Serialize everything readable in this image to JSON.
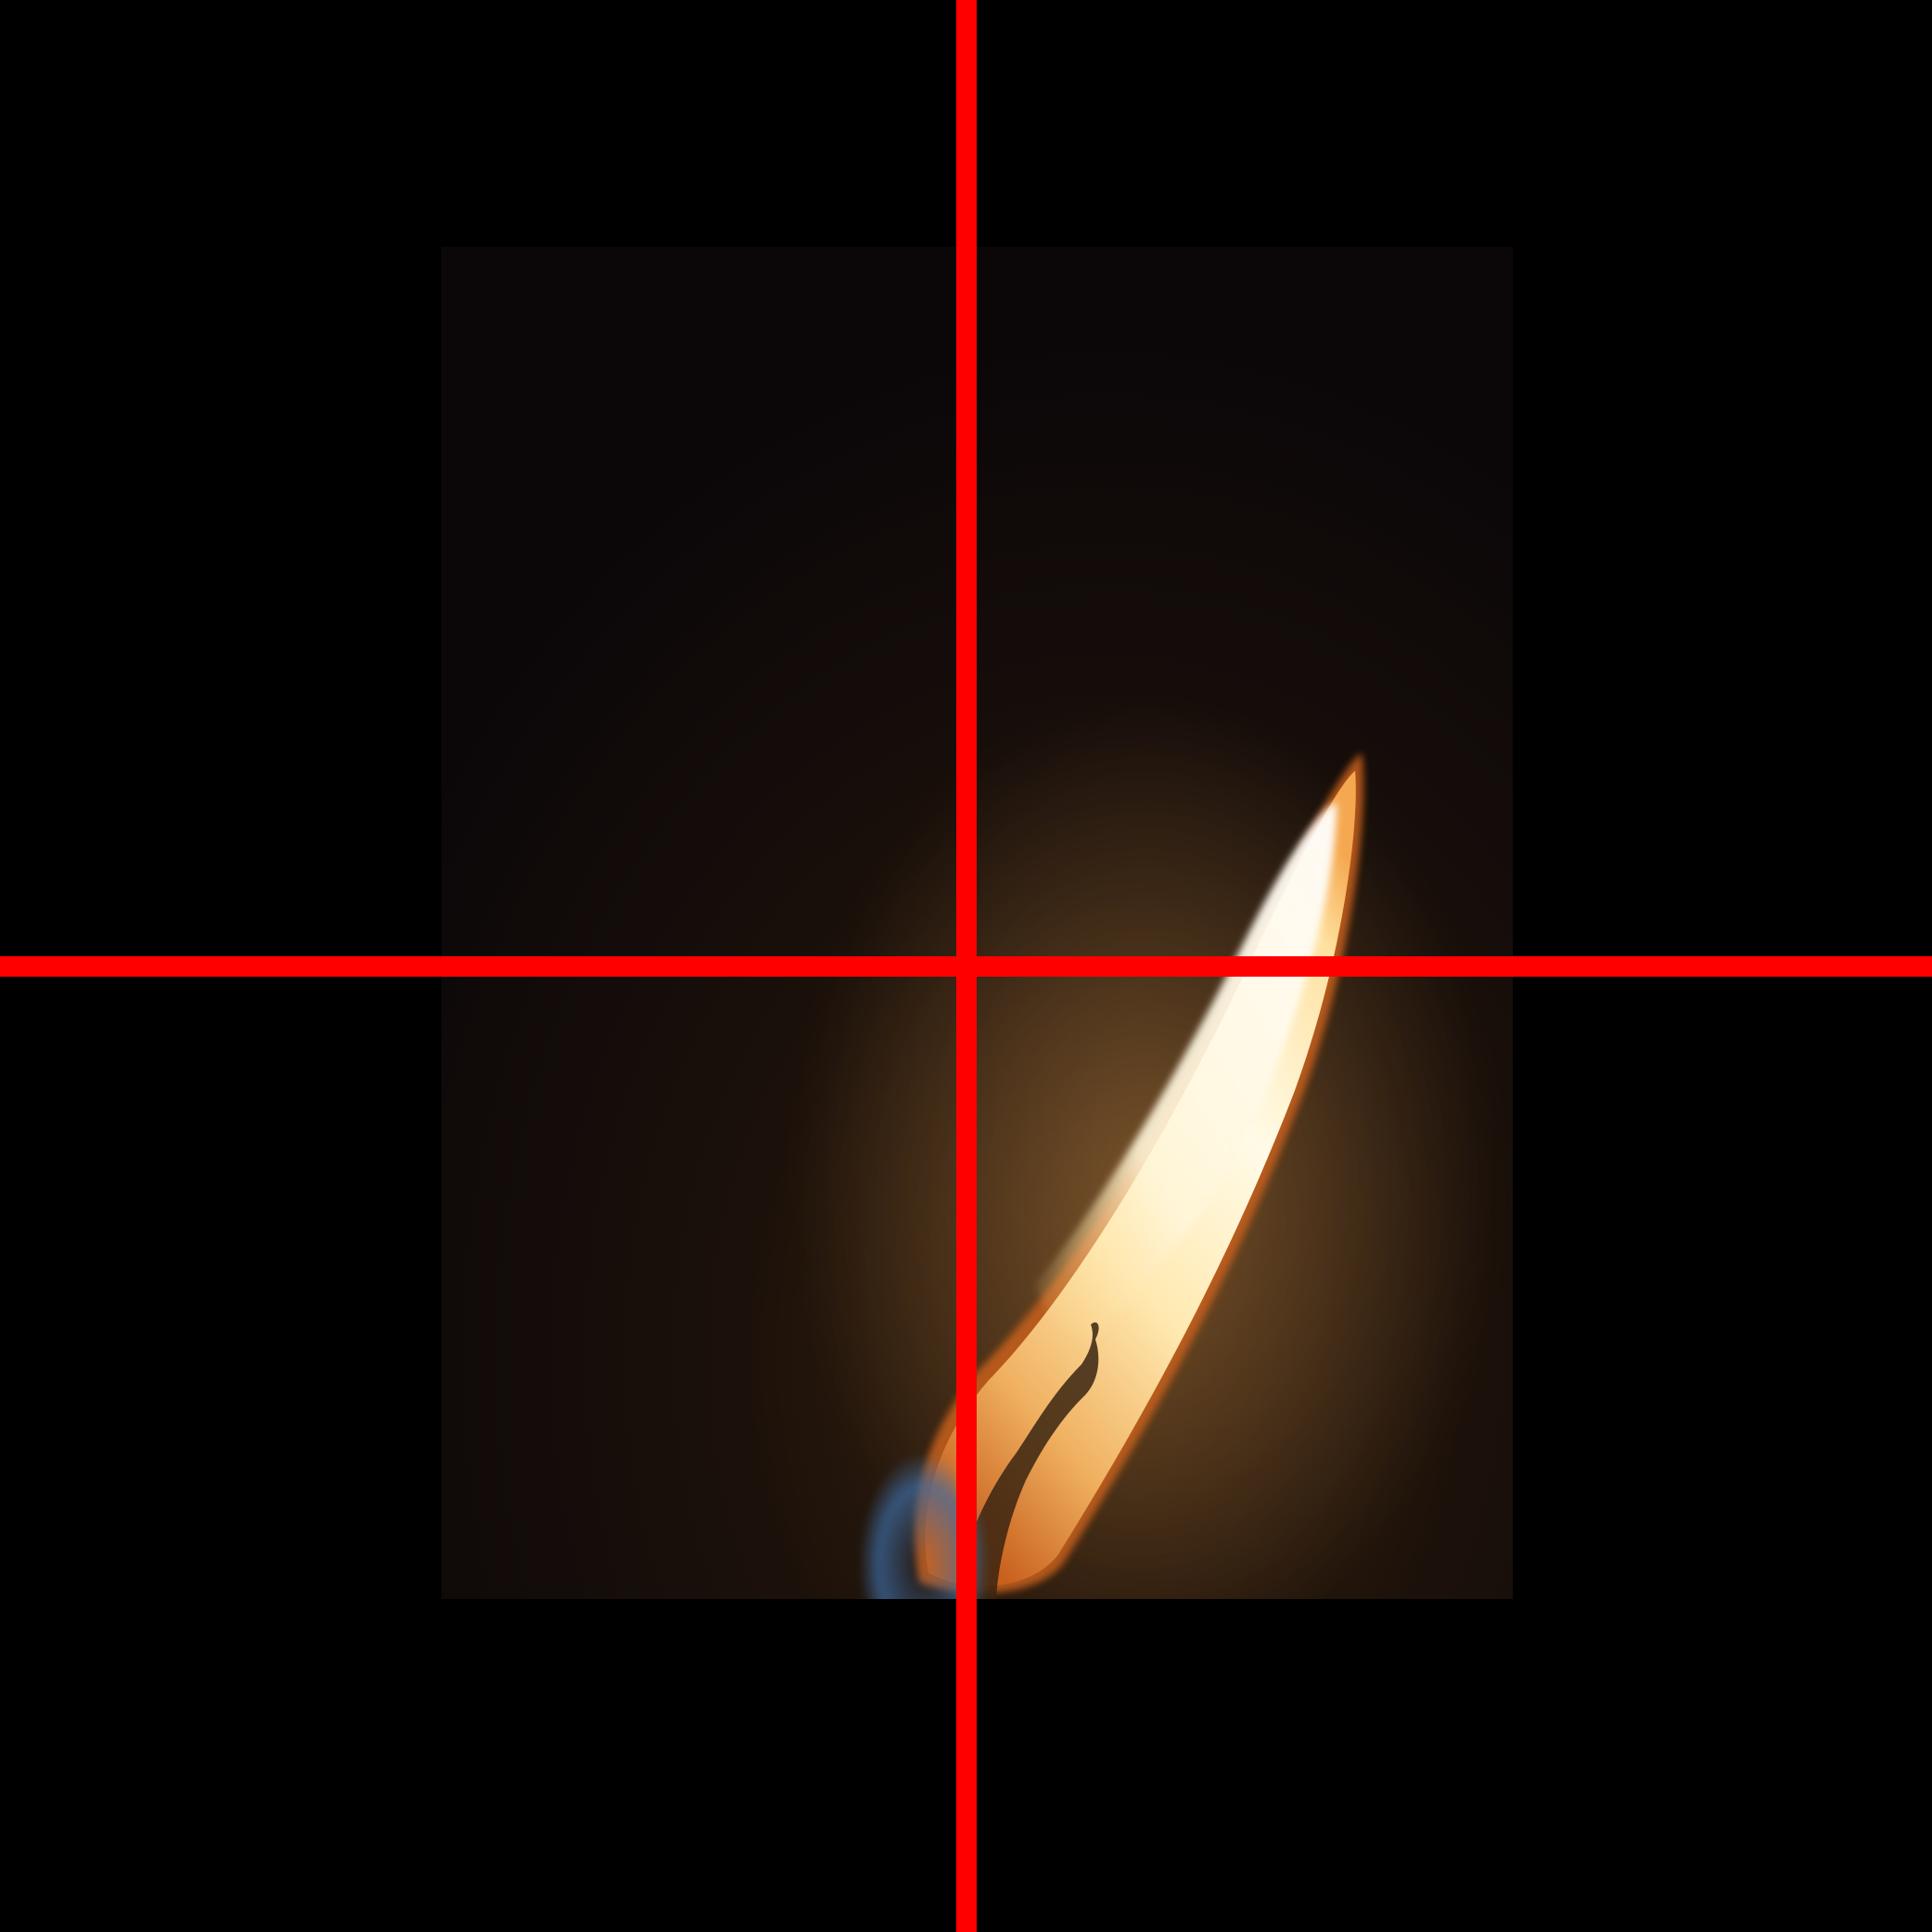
{
  "image": {
    "subject": "candle-flame",
    "background_color": "#000000"
  },
  "photo": {
    "dark_tone": "#0a0608",
    "warm_tone": "#2a1a0c",
    "flame_core": "#fffbe8",
    "flame_mid": "#ffd27a",
    "flame_edge": "#c8611e",
    "wick_color": "#3a2410",
    "base_blue": "#3d6ea8"
  },
  "overlay": {
    "guide_color": "#ff0000",
    "guide_names": [
      "vertical-guide-line",
      "horizontal-guide-line"
    ]
  }
}
